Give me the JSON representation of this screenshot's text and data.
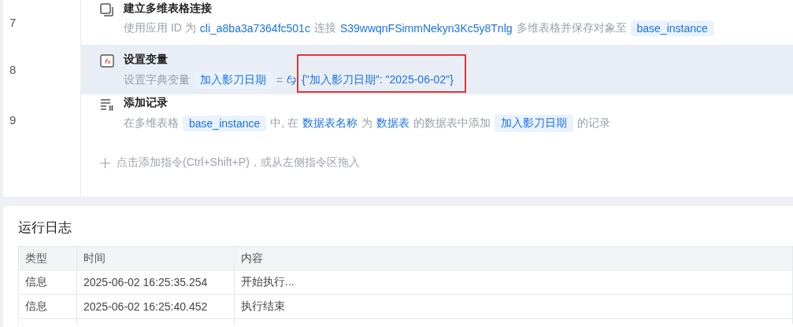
{
  "steps": [
    {
      "number": "7",
      "kind": "connect",
      "title": "建立多维表格连接",
      "selected": false,
      "parts": [
        {
          "kind": "text",
          "text": "使用应用 ID 为"
        },
        {
          "kind": "link",
          "text": "cli_a8ba3a7364fc501c"
        },
        {
          "kind": "text",
          "text": "连接"
        },
        {
          "kind": "link",
          "text": "S39wwqnFSimmNekyn3Kc5y8Tnlg"
        },
        {
          "kind": "text",
          "text": "多维表格并保存对象至"
        },
        {
          "kind": "tag",
          "text": "base_instance"
        }
      ]
    },
    {
      "number": "8",
      "kind": "function",
      "title": "设置变量",
      "selected": true,
      "parts": [
        {
          "kind": "text",
          "text": "设置字典变量"
        },
        {
          "kind": "tag",
          "text": "加入影刀日期"
        },
        {
          "kind": "text",
          "text": "="
        },
        {
          "kind": "python",
          "text": "{\"加入影刀日期\": \"2025-06-02\"}",
          "highlighted": true
        }
      ]
    },
    {
      "number": "9",
      "kind": "record",
      "title": "添加记录",
      "selected": false,
      "parts": [
        {
          "kind": "text",
          "text": "在多维表格"
        },
        {
          "kind": "tag",
          "text": "base_instance"
        },
        {
          "kind": "text",
          "text": "中, 在"
        },
        {
          "kind": "link",
          "text": "数据表名称"
        },
        {
          "kind": "text",
          "text": "为"
        },
        {
          "kind": "link",
          "text": "数据表"
        },
        {
          "kind": "text",
          "text": "的数据表中添加"
        },
        {
          "kind": "tag",
          "text": "加入影刀日期"
        },
        {
          "kind": "text",
          "text": "的记录"
        }
      ]
    }
  ],
  "add_hint": "点击添加指令(Ctrl+Shift+P)，或从左侧指令区拖入",
  "log": {
    "title": "运行日志",
    "columns": [
      "类型",
      "时间",
      "内容"
    ],
    "rows": [
      [
        "信息",
        "2025-06-02 16:25:35.254",
        "开始执行..."
      ],
      [
        "信息",
        "2025-06-02 16:25:40.452",
        "执行结束"
      ]
    ]
  }
}
